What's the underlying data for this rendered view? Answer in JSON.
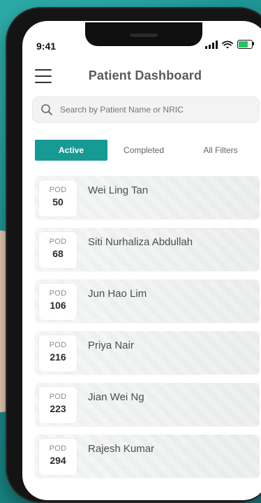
{
  "status": {
    "time": "9:41"
  },
  "header": {
    "title": "Patient Dashboard"
  },
  "search": {
    "placeholder": "Search by Patient Name or NRIC"
  },
  "tabs": [
    {
      "label": "Active",
      "active": true
    },
    {
      "label": "Completed",
      "active": false
    },
    {
      "label": "All Filters",
      "active": false
    }
  ],
  "patients": [
    {
      "pod_label": "POD",
      "pod_number": "50",
      "name": "Wei Ling Tan"
    },
    {
      "pod_label": "POD",
      "pod_number": "68",
      "name": "Siti Nurhaliza Abdullah"
    },
    {
      "pod_label": "POD",
      "pod_number": "106",
      "name": "Jun Hao Lim"
    },
    {
      "pod_label": "POD",
      "pod_number": "216",
      "name": "Priya Nair"
    },
    {
      "pod_label": "POD",
      "pod_number": "223",
      "name": "Jian Wei Ng"
    },
    {
      "pod_label": "POD",
      "pod_number": "294",
      "name": "Rajesh Kumar"
    }
  ],
  "colors": {
    "accent": "#169a94",
    "background": "#1f9a98",
    "battery": "#22c55e"
  },
  "icons": {
    "menu": "hamburger-menu-icon",
    "search": "search-icon",
    "signal": "signal-icon",
    "wifi": "wifi-icon",
    "battery": "battery-icon"
  }
}
